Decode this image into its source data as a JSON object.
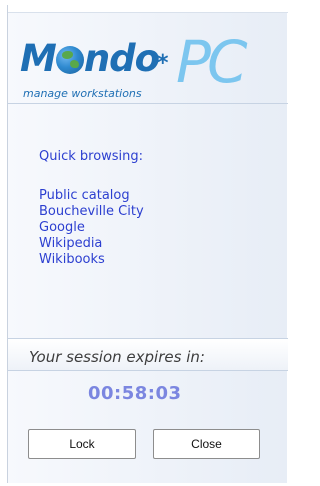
{
  "logo": {
    "word": "M",
    "word_rest": "ndo",
    "star": "*",
    "pc": "PC",
    "tagline": "manage workstations"
  },
  "quick_browsing": {
    "title": "Quick browsing:",
    "links": [
      {
        "label": "Public catalog"
      },
      {
        "label": "Boucheville City"
      },
      {
        "label": "Google"
      },
      {
        "label": "Wikipedia"
      },
      {
        "label": "Wikibooks"
      }
    ]
  },
  "session": {
    "label": "Your session expires in:",
    "timer": "00:58:03"
  },
  "buttons": {
    "lock": "Lock",
    "close": "Close"
  },
  "colors": {
    "link": "#2c3fd0",
    "timer": "#7b86e0",
    "logo_blue": "#1f6fb4",
    "logo_light_blue": "#7cc6ef"
  }
}
